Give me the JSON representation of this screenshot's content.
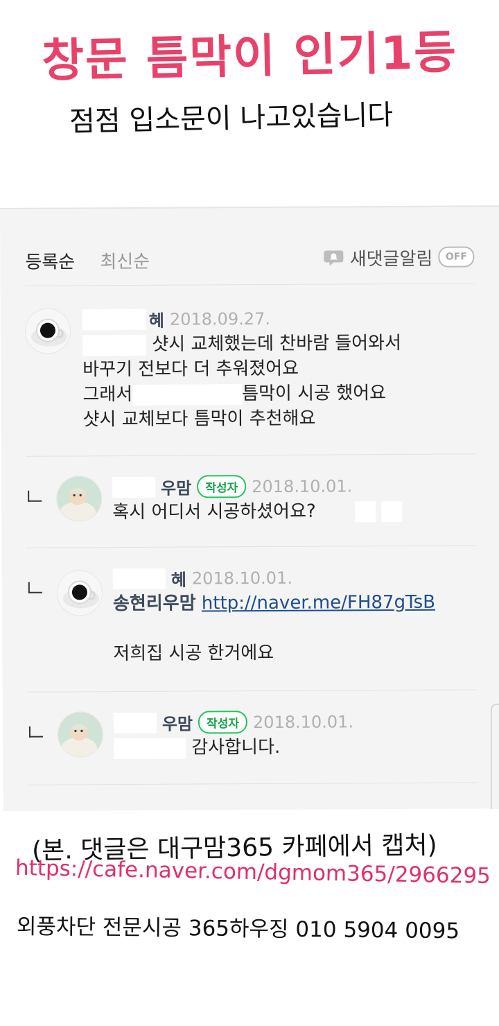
{
  "headline": "창문 틈막이 인기1등",
  "subheadline": "점점 입소문이 나고있습니다",
  "sort_bar": {
    "tab_registered": "등록순",
    "tab_latest": "최신순",
    "notify_label": "새댓글알림",
    "notify_toggle": "OFF"
  },
  "comments": [
    {
      "nickname": "혜",
      "date": "2018.09.27.",
      "lines": [
        "샷시 교체했는데 찬바람 들어와서",
        "바꾸기 전보다 더 추워졌어요",
        "그래서",
        "틈막이 시공 했어요",
        "샷시 교체보다 틈막이 추천해요"
      ]
    },
    {
      "nickname": "우맘",
      "badge": "작성자",
      "date": "2018.10.01.",
      "lines": [
        "혹시 어디서 시공하셨어요?"
      ]
    },
    {
      "nickname": "혜",
      "date": "2018.10.01.",
      "mention": "송현리우맘",
      "link": "http://naver.me/FH87gTsB",
      "lines": [
        "저희집 시공 한거에요"
      ]
    },
    {
      "nickname": "우맘",
      "badge": "작성자",
      "date": "2018.10.01.",
      "lines": [
        "감사합니다."
      ]
    }
  ],
  "caption": "(본. 댓글은 대구맘365 카페에서 캡처)",
  "source_url": "https://cafe.naver.com/dgmom365/2966295",
  "contact": "외풍차단 전문시공 365하우징 010 5904 0095",
  "colors": {
    "headline": "#e8426a",
    "source_url": "#e0306a",
    "badge": "#22c55e",
    "link": "#1f4e8c",
    "panel_bg": "#f4f4f4"
  },
  "icons": {
    "notify": "speech-bubble-bell-icon",
    "reply": "reply-arrow-icon",
    "avatar_1": "coffee-cup-avatar",
    "avatar_2": "baby-photo-avatar"
  }
}
